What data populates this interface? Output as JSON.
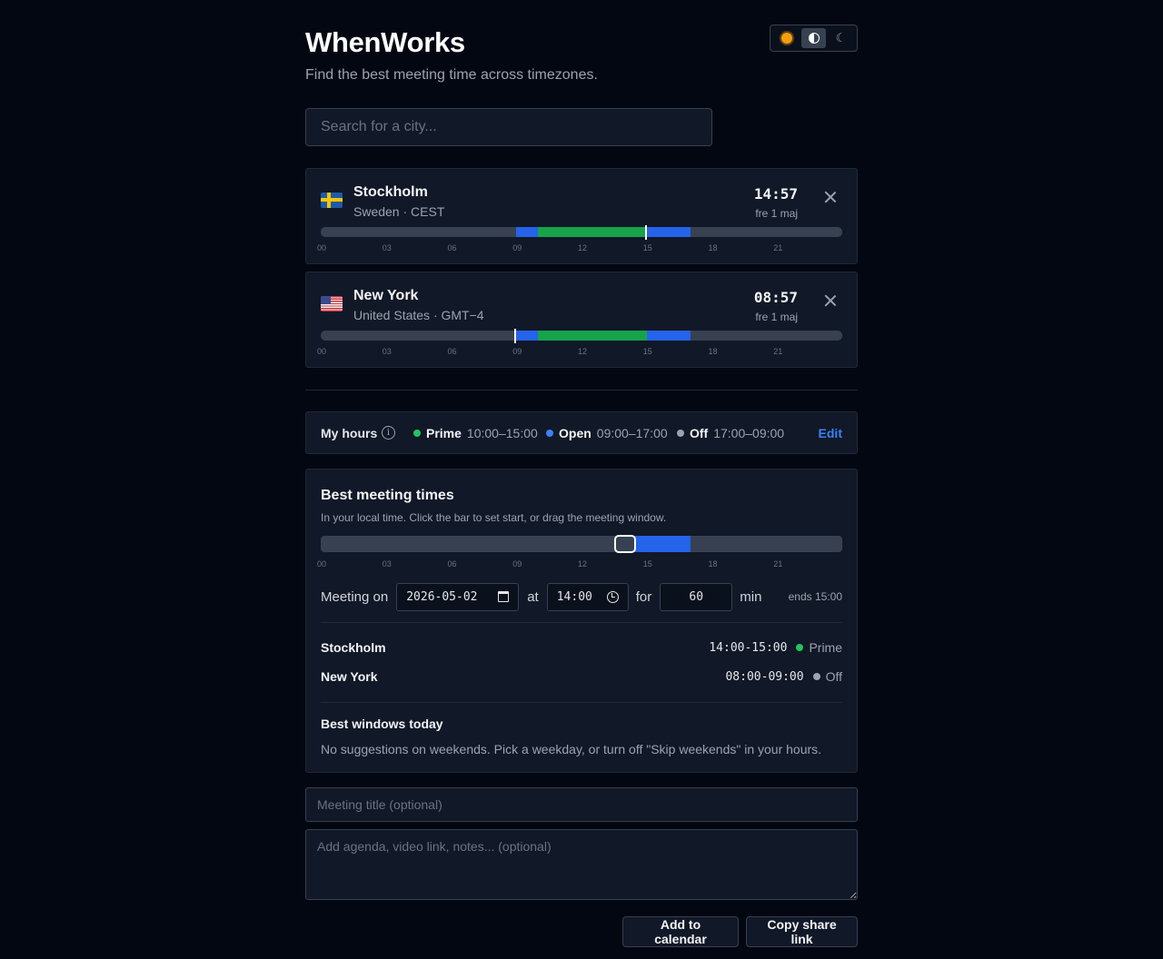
{
  "app": {
    "title": "WhenWorks",
    "subtitle": "Find the best meeting time across timezones."
  },
  "theme_toggle": {
    "options": [
      {
        "icon": "sun-icon",
        "active": false
      },
      {
        "icon": "contrast-icon",
        "active": true
      },
      {
        "icon": "moon-icon",
        "active": false
      }
    ]
  },
  "search": {
    "placeholder": "Search for a city..."
  },
  "timeline_ticks": [
    "00",
    "03",
    "06",
    "09",
    "12",
    "15",
    "18",
    "21"
  ],
  "cities": [
    {
      "name": "Stockholm",
      "sub": "Sweden · CEST",
      "flag": "sweden-flag-icon",
      "time": "14:57",
      "date": "fre 1 maj",
      "now_hour": 14.95
    },
    {
      "name": "New York",
      "sub": "United States · GMT−4",
      "flag": "us-flag-icon",
      "time": "08:57",
      "date": "fre 1 maj",
      "now_hour": 8.95
    }
  ],
  "my_hours": {
    "label": "My hours",
    "info_glyph": "i",
    "prime_label": "Prime",
    "prime_range": "10:00–15:00",
    "open_label": "Open",
    "open_range": "09:00–17:00",
    "off_label": "Off",
    "off_range": "17:00–09:00",
    "edit_label": "Edit",
    "prime_start": 10,
    "prime_end": 15,
    "open_start": 9,
    "open_end": 17,
    "colors": {
      "prime": "#22c55e",
      "open": "#3b82f6",
      "off": "#9ca3af"
    }
  },
  "best": {
    "title": "Best meeting times",
    "hint": "In your local time. Click the bar to set start, or drag the meeting window.",
    "meeting_on_label": "Meeting on",
    "date_value": "2026-05-02",
    "at_label": "at",
    "time_value": "14:00",
    "for_label": "for",
    "duration_value": "60",
    "min_label": "min",
    "ends": "ends 15:00",
    "participants": [
      {
        "city": "Stockholm",
        "range": "14:00-15:00",
        "status": "Prime"
      },
      {
        "city": "New York",
        "range": "08:00-09:00",
        "status": "Off"
      }
    ],
    "windows_title": "Best windows today",
    "windows_text": "No suggestions on weekends. Pick a weekday, or turn off \"Skip weekends\" in your hours."
  },
  "meeting_title": {
    "placeholder": "Meeting title (optional)"
  },
  "notes": {
    "placeholder": "Add agenda, video link, notes... (optional)"
  },
  "actions": {
    "add_calendar": "Add to calendar",
    "copy_link": "Copy share link"
  }
}
